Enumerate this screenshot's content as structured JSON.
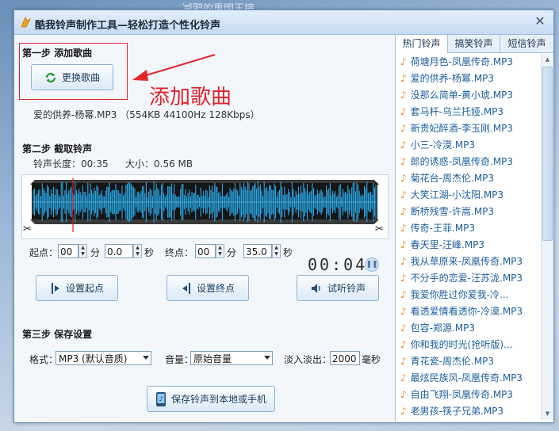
{
  "background_text": "减肥的重明王搞",
  "window": {
    "title": "酷我铃声制作工具—轻松打造个性化铃声",
    "close_glyph": "✕"
  },
  "step1": {
    "title": "第一步  添加歌曲",
    "change_button": "更换歌曲",
    "annotation": "添加歌曲",
    "file_info": "爱的供养-杨幂.MP3 （554KB 44100Hz 128Kbps）"
  },
  "step2": {
    "title": "第二步  截取铃声",
    "length_label": "铃声长度：",
    "length_value": "00:35",
    "size_label": "大小：",
    "size_value": "0.56 MB",
    "start_label": "起点：",
    "start_min": "00",
    "min_unit": "分",
    "start_sec": "0.0",
    "sec_unit": "秒",
    "end_label": "终点：",
    "end_min": "00",
    "end_sec": "35.0",
    "timer": "00:04",
    "btn_set_start": "设置起点",
    "btn_set_end": "设置终点",
    "btn_preview": "试听铃声"
  },
  "step3": {
    "title": "第三步  保存设置",
    "format_label": "格式：",
    "format_value": "MP3 (默认音质)",
    "volume_label": "音量：",
    "volume_value": "原始音量",
    "fade_label": "淡入淡出：",
    "fade_value": "2000",
    "fade_unit": "毫秒",
    "save_button": "保存铃声到本地或手机"
  },
  "tabs": [
    "热门铃声",
    "搞笑铃声",
    "短信铃声"
  ],
  "ringtones": [
    "荷塘月色-凤凰传奇.MP3",
    "爱的供养-杨幂.MP3",
    "没那么简单-黄小琥.MP3",
    "套马杆-乌兰托娅.MP3",
    "新贵妃醉酒-李玉刚.MP3",
    "小三-冷漠.MP3",
    "郎的诱惑-凤凰传奇.MP3",
    "菊花台-周杰伦.MP3",
    "大笑江湖-小沈阳.MP3",
    "断桥残雪-许嵩.MP3",
    "传奇-王菲.MP3",
    "春天里-汪峰.MP3",
    "我从草原来-凤凰传奇.MP3",
    "不分手的恋爱-汪苏泷.MP3",
    "我爱你胜过你爱我-冷...",
    "看透爱情看透你-冷漠.MP3",
    "包容-郑源.MP3",
    "你和我的时光(抢听版)...",
    "青花瓷-周杰伦.MP3",
    "最炫民族风-凤凰传奇.MP3",
    "自由飞翔-凤凰传奇.MP3",
    "老男孩-筷子兄弟.MP3"
  ],
  "colors": {
    "accent_red": "#e0242b",
    "link_blue": "#1c5ea0",
    "wave_blue": "#29a9e8"
  },
  "icons": {
    "note": "♪"
  }
}
